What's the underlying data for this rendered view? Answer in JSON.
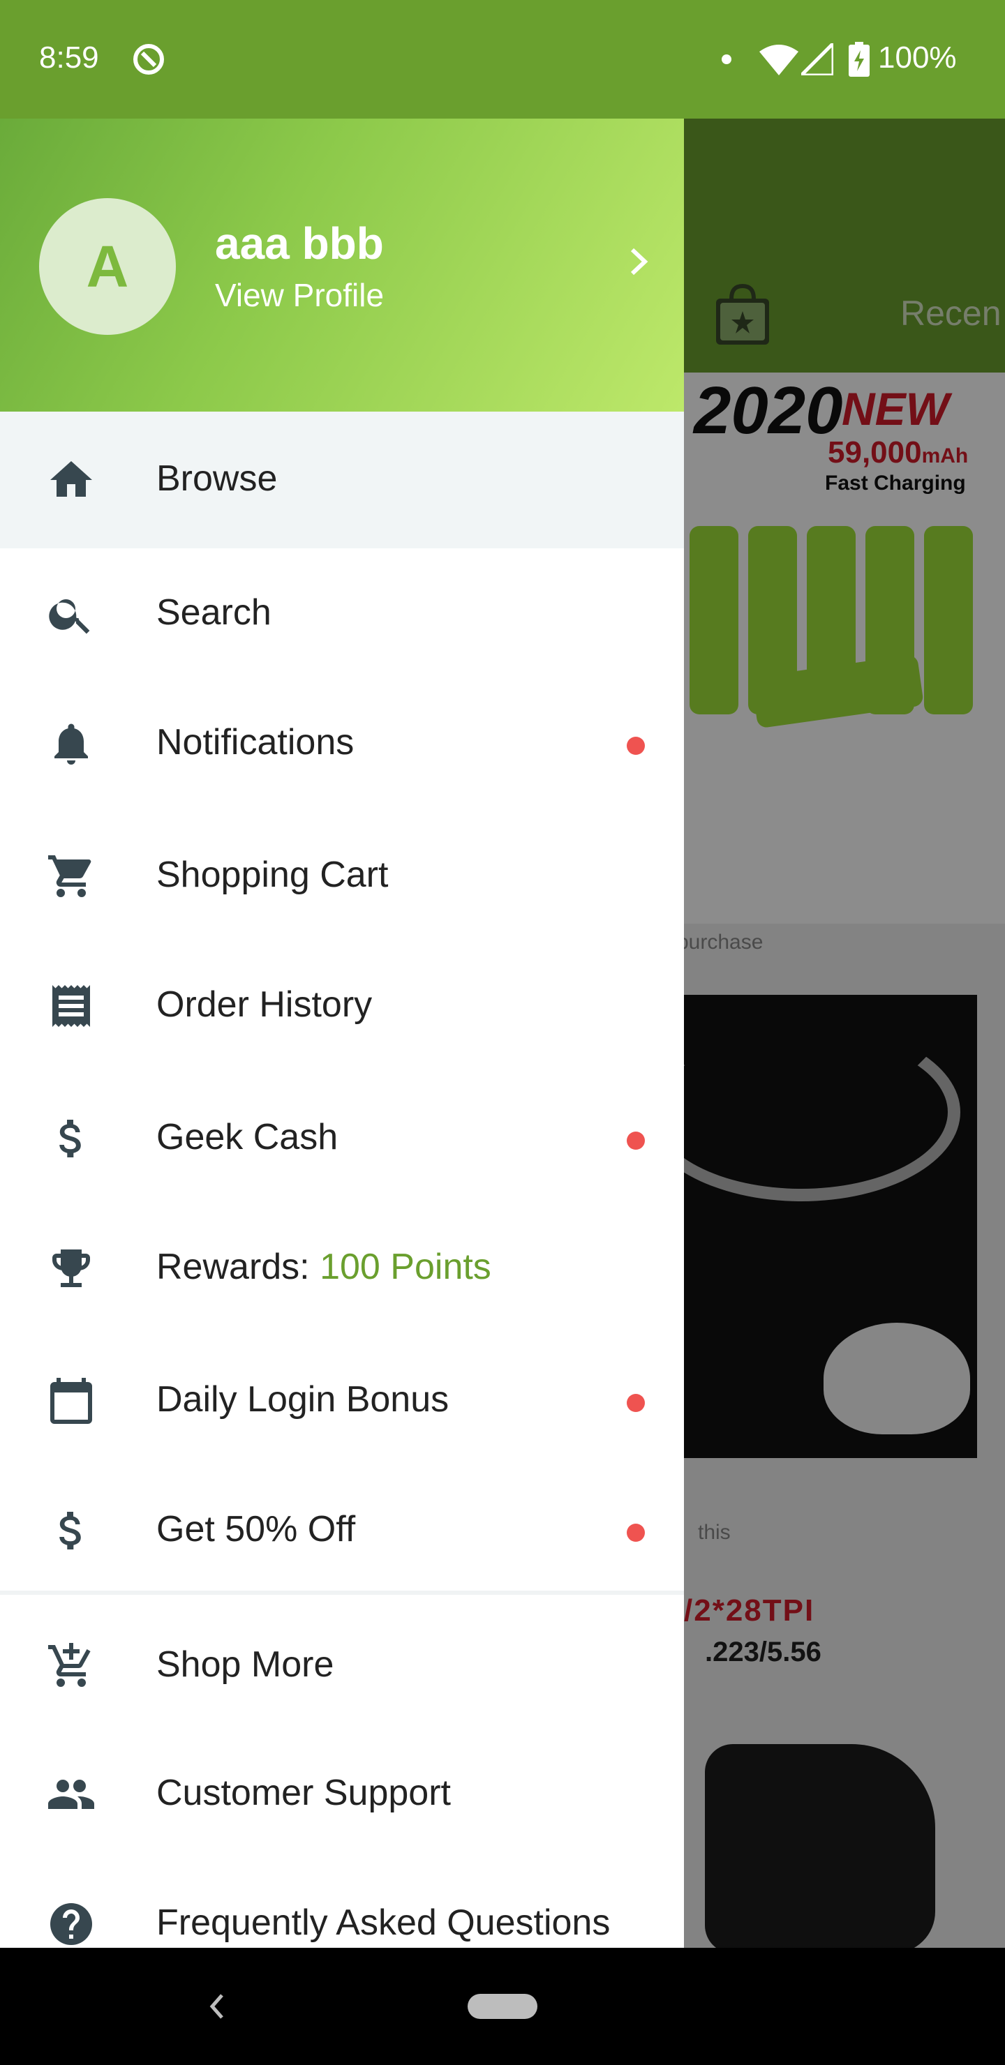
{
  "status_bar": {
    "time": "8:59",
    "battery": "100%"
  },
  "background": {
    "tab_recent": "Recen",
    "ad": {
      "year": "2020",
      "new_label": "NEW",
      "capacity": "59,000",
      "capacity_unit": "mAh",
      "charging": "Fast Charging"
    },
    "caption_1": "purchase",
    "caption_2": "this",
    "thread_line_1": "/2*28TPI",
    "thread_line_2": ".223/5.56"
  },
  "drawer": {
    "avatar_letter": "A",
    "user_name": "aaa bbb",
    "view_profile": "View Profile",
    "items": [
      {
        "label": "Browse",
        "icon": "home-icon",
        "badge": false,
        "active": true
      },
      {
        "label": "Search",
        "icon": "search-icon",
        "badge": false
      },
      {
        "label": "Notifications",
        "icon": "bell-icon",
        "badge": true
      },
      {
        "label": "Shopping Cart",
        "icon": "cart-icon",
        "badge": false
      },
      {
        "label": "Order History",
        "icon": "receipt-icon",
        "badge": false
      },
      {
        "label": "Geek Cash",
        "icon": "dollar-icon",
        "badge": true
      },
      {
        "label": "Rewards: ",
        "accent": "100 Points",
        "icon": "trophy-icon",
        "badge": false
      },
      {
        "label": "Daily Login Bonus",
        "icon": "calendar-icon",
        "badge": true
      },
      {
        "label": "Get 50% Off",
        "icon": "dollar-icon",
        "badge": true
      },
      {
        "label": "Shop More",
        "icon": "add-cart-icon",
        "badge": false
      },
      {
        "label": "Customer Support",
        "icon": "people-icon",
        "badge": false
      },
      {
        "label": "Frequently Asked Questions",
        "icon": "help-icon",
        "badge": false
      }
    ]
  },
  "colors": {
    "brand_green": "#6a9f2e",
    "badge_red": "#ef5350",
    "active_row": "#f1f5f6"
  }
}
